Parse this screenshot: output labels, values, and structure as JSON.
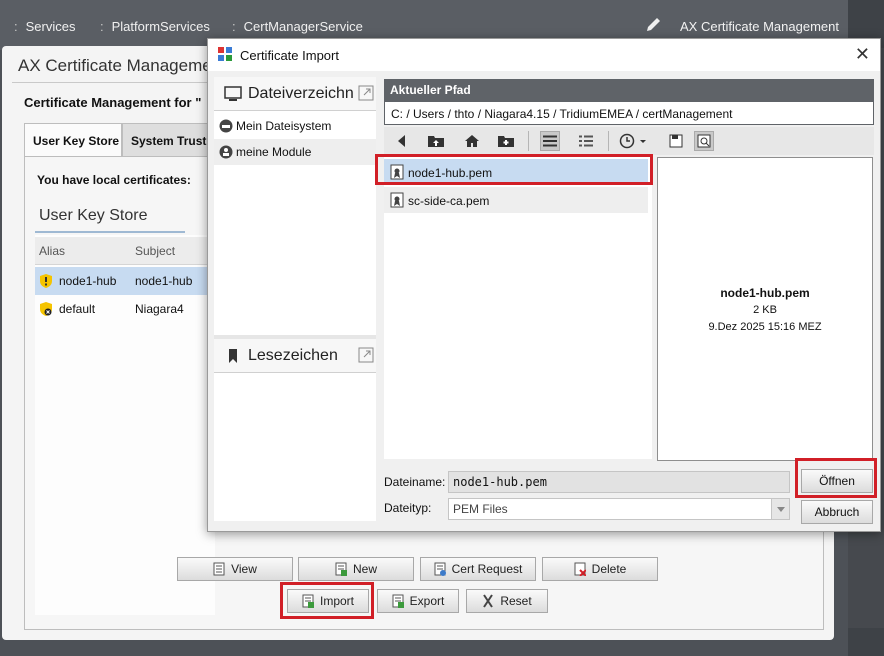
{
  "topbar": {
    "crumbs": [
      "Services",
      "PlatformServices",
      "CertManagerService"
    ],
    "view_title": "AX Certificate Management"
  },
  "panel": {
    "title": "AX Certificate Manageme",
    "cert_for": "Certificate Management for \"",
    "tabs": [
      "User Key Store",
      "System Trust S"
    ],
    "local_text": "You have local certificates:",
    "section_title": "User Key Store",
    "columns": [
      "Alias",
      "Subject"
    ],
    "rows": [
      {
        "alias": "node1-hub",
        "subject": "node1-hub"
      },
      {
        "alias": "default",
        "subject": "Niagara4"
      }
    ],
    "buttons_row1": [
      "View",
      "New",
      "Cert Request",
      "Delete"
    ],
    "buttons_row2": [
      "Import",
      "Export",
      "Reset"
    ]
  },
  "dialog": {
    "title": "Certificate Import",
    "sidebar": {
      "places_title": "Dateiverzeichn",
      "places": [
        "Mein Dateisystem",
        "meine Module"
      ],
      "bookmarks_title": "Lesezeichen"
    },
    "path_header": "Aktueller Pfad",
    "path_value": "C: / Users / thto / Niagara4.15 / TridiumEMEA / certManagement",
    "files": [
      "node1-hub.pem",
      "sc-side-ca.pem"
    ],
    "preview": {
      "name": "node1-hub.pem",
      "size": "2 KB",
      "date": "9.Dez 2025 15:16 MEZ"
    },
    "filename_label": "Dateiname:",
    "filename_value": "node1-hub.pem",
    "filetype_label": "Dateityp:",
    "filetype_value": "PEM Files",
    "open_label": "Öffnen",
    "cancel_label": "Abbruch"
  },
  "colors": {
    "highlight_box": "#d11f27",
    "selection": "#c7dbf1",
    "path_header_bg": "#5f6368"
  }
}
